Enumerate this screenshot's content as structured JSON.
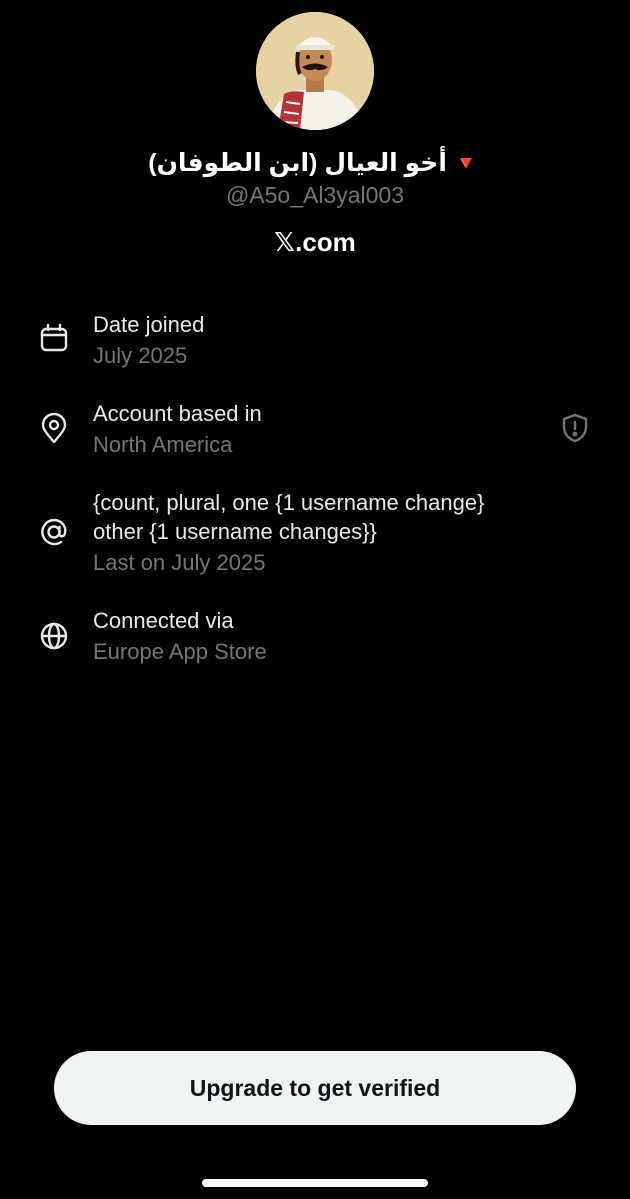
{
  "profile": {
    "display_name": "أخو العيال (ابن الطوفان)",
    "flag_glyph": "🔻",
    "handle": "@A5o_Al3yal003",
    "domain": "𝕏.com"
  },
  "info_rows": [
    {
      "icon": "calendar-icon",
      "title": "Date joined",
      "subtitle": "July 2025"
    },
    {
      "icon": "location-pin-icon",
      "title": "Account based in",
      "subtitle": "North America"
    },
    {
      "icon": "at-sign-icon",
      "title_line1": "{count, plural, one {1 username change}",
      "title_line2": "other {1 username changes}}",
      "subtitle": "Last on July 2025"
    },
    {
      "icon": "globe-icon",
      "title": "Connected via",
      "subtitle": "Europe App Store"
    }
  ],
  "upgrade_button": {
    "label": "Upgrade to get verified"
  },
  "colors": {
    "background": "#000000",
    "primary_text": "#e7e9ea",
    "secondary_text": "#71767b",
    "button_bg": "#eff3f4",
    "flag": "#e0245e"
  }
}
